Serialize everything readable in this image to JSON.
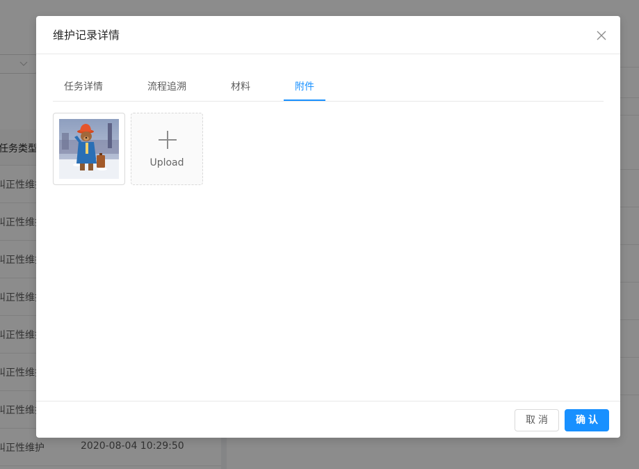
{
  "background": {
    "table_header": "任务类型",
    "rows": [
      {
        "type": "纠正性维护",
        "time": ""
      },
      {
        "type": "纠正性维护",
        "time": ""
      },
      {
        "type": "纠正性维护",
        "time": ""
      },
      {
        "type": "纠正性维护",
        "time": ""
      },
      {
        "type": "纠正性维护",
        "time": ""
      },
      {
        "type": "纠正性维护",
        "time": ""
      },
      {
        "type": "纠正性维护",
        "time": ""
      },
      {
        "type": "纠正性维护",
        "time": "2020-08-04 10:29:50"
      }
    ]
  },
  "modal": {
    "title": "维护记录详情",
    "close_icon": "close-icon",
    "tabs": [
      {
        "label": "任务详情",
        "active": false
      },
      {
        "label": "流程追溯",
        "active": false
      },
      {
        "label": "材料",
        "active": false
      },
      {
        "label": "附件",
        "active": true
      }
    ],
    "attachments": [
      {
        "kind": "image",
        "description": "bear-in-blue-coat-thumbnail"
      }
    ],
    "upload": {
      "icon": "plus-icon",
      "label": "Upload"
    },
    "footer": {
      "cancel_label": "取消",
      "ok_label": "确认"
    }
  },
  "colors": {
    "primary": "#1890ff",
    "mask": "rgba(0,0,0,0.45)",
    "border": "#e8e8e8"
  }
}
